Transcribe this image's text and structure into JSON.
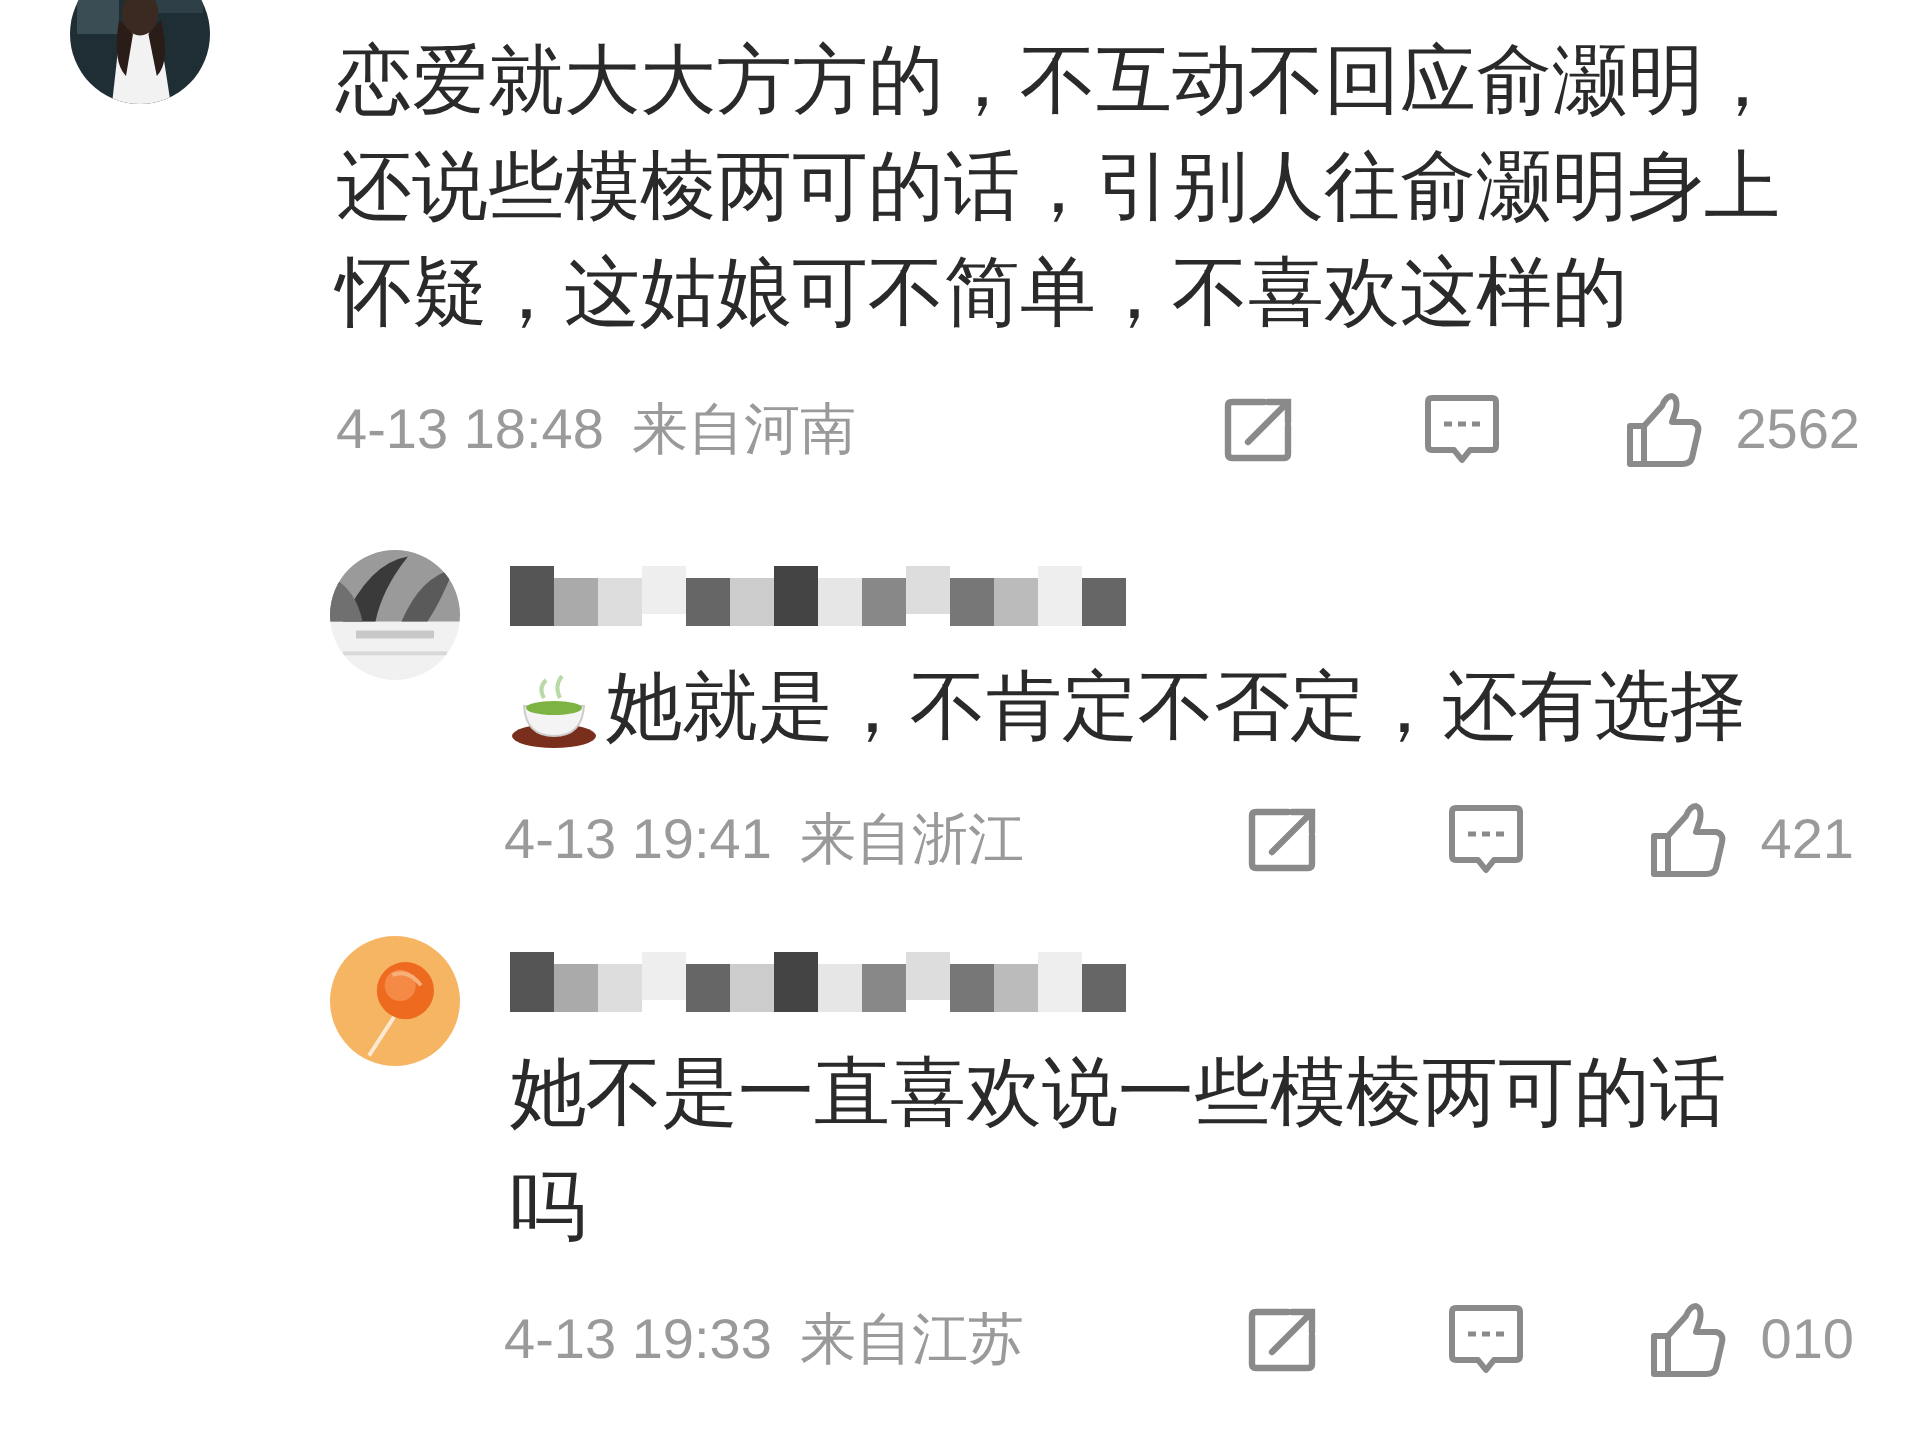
{
  "comment": {
    "avatar": {
      "kind": "figure"
    },
    "text": "恋爱就大大方方的，不互动不回应俞灏明，还说些模棱两可的话，引别人往俞灏明身上怀疑，这姑娘可不简单，不喜欢这样的",
    "time": "4-13 18:48",
    "location": "来自河南",
    "likes": "2562"
  },
  "replies": [
    {
      "avatar": {
        "kind": "leaves"
      },
      "username": {
        "kind": "pixelated"
      },
      "leading_icon": {
        "kind": "tea"
      },
      "text": "她就是，不肯定不否定，还有选择",
      "time": "4-13 19:41",
      "location": "来自浙江",
      "likes": "421"
    },
    {
      "avatar": {
        "kind": "lollipop"
      },
      "username": {
        "kind": "pixelated"
      },
      "text": "她不是一直喜欢说一些模棱两可的话吗",
      "time": "4-13 19:33",
      "location": "来自江苏",
      "likes": "010"
    }
  ]
}
